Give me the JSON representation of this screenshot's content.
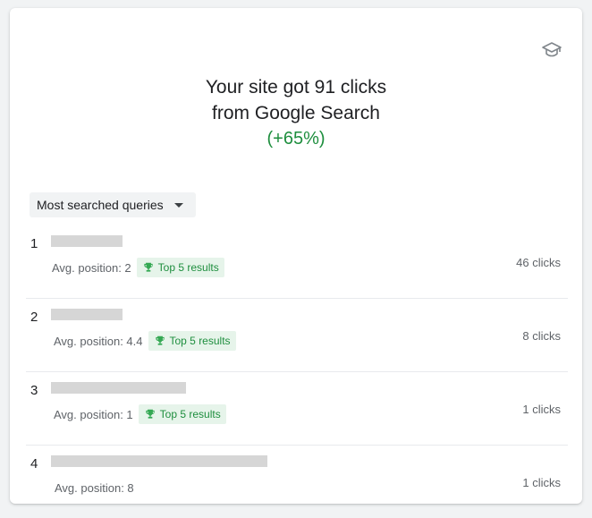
{
  "headline": {
    "line1": "Your site got 91 clicks",
    "line2": "from Google Search",
    "delta": "(+65%)"
  },
  "dropdown": {
    "label": "Most searched queries"
  },
  "icons": {
    "top": "graduation-cap-icon",
    "badge": "trophy-icon",
    "dropdown": "caret-down-icon"
  },
  "colors": {
    "positive": "#1e8e3e",
    "badge_bg": "#e6f4ea",
    "placeholder": "#d6d6d6"
  },
  "queries": [
    {
      "rank": "1",
      "position": "Avg. position: 2",
      "badge": "Top 5 results",
      "clicks": "46 clicks"
    },
    {
      "rank": "2",
      "position": "Avg. position: 4.4",
      "badge": "Top 5 results",
      "clicks": "8 clicks"
    },
    {
      "rank": "3",
      "position": "Avg. position: 1",
      "badge": "Top 5 results",
      "clicks": "1 clicks"
    },
    {
      "rank": "4",
      "position": "Avg. position: 8",
      "clicks": "1 clicks"
    }
  ]
}
